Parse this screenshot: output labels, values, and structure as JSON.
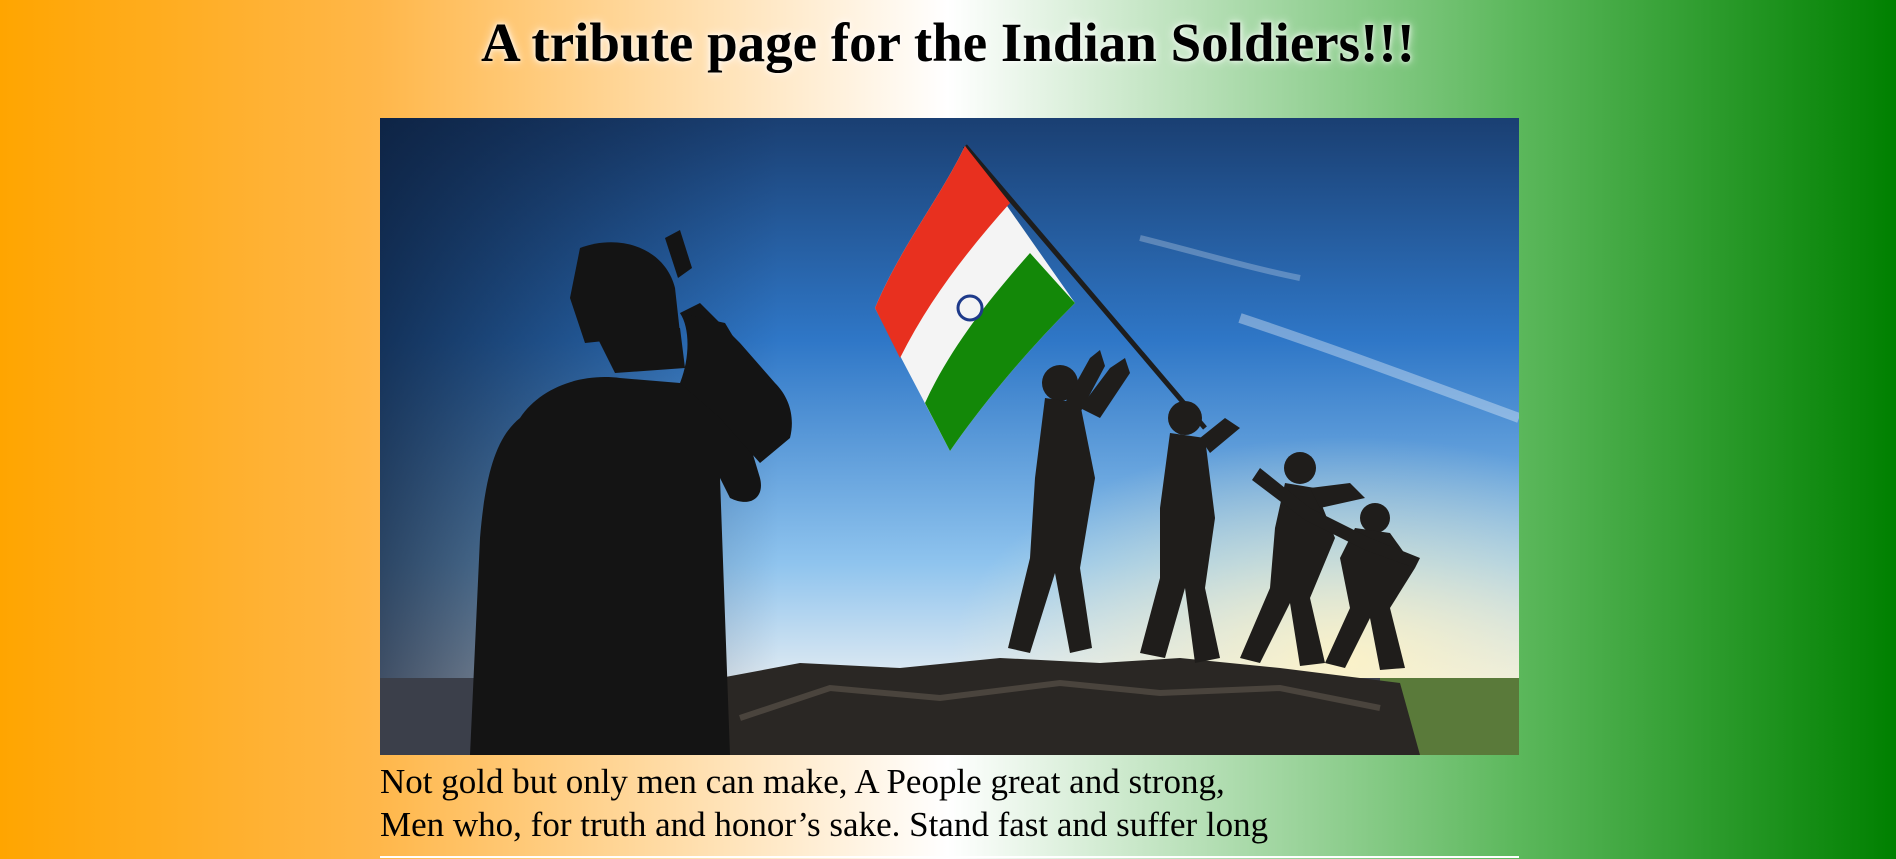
{
  "page": {
    "title": "A tribute page for the Indian Soldiers!!!",
    "background_colors": [
      "#ffa500",
      "#ffffff",
      "#008000"
    ]
  },
  "hero_image": {
    "subject": "silhouette of a saluting soldier facing a statue of soldiers raising the Indian flag",
    "flag_colors": [
      "#e8301f",
      "#f4f4f4",
      "#138808"
    ]
  },
  "poem": {
    "line1": "Not gold but only men can make, A People great and strong,",
    "line2": "Men who, for truth and honor’s sake. Stand fast and suffer long"
  }
}
